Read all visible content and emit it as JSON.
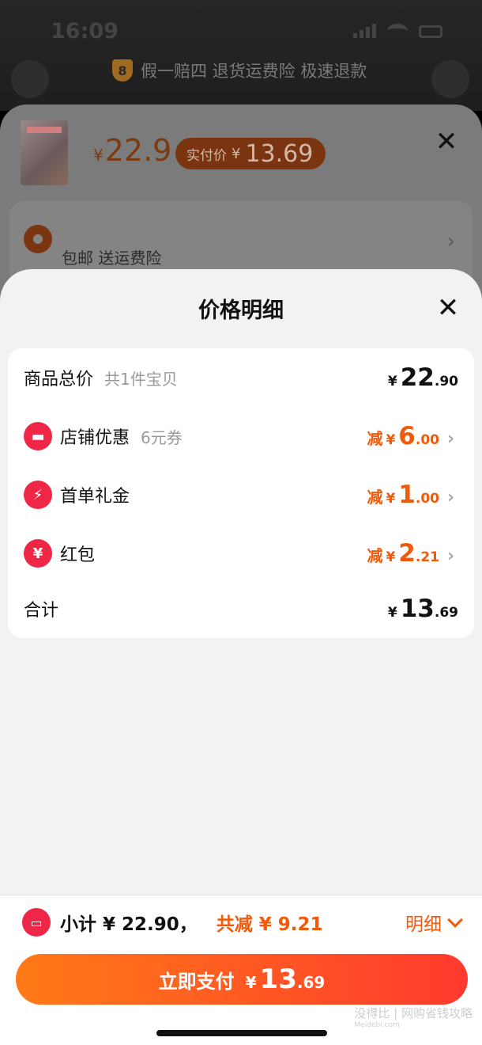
{
  "status_bar": {
    "time": "16:09"
  },
  "guarantee": {
    "shield_char": "8",
    "text": "假一赔四 退货运费险 极速退款"
  },
  "product": {
    "currency": "¥",
    "price": "22.9",
    "paid_label": "实付价",
    "paid_currency": "¥",
    "paid_price": "13.69"
  },
  "shipping": {
    "text": "包邮  送运费险"
  },
  "sheet": {
    "title": "价格明细",
    "close_char": "✕"
  },
  "detail": {
    "total": {
      "label": "商品总价",
      "sub": "共1件宝贝",
      "currency": "¥",
      "int": "22",
      "dec": ".90"
    },
    "items": [
      {
        "label": "店铺优惠",
        "sub": "6元券",
        "prefix": "减",
        "currency": "¥",
        "int": "6",
        "dec": ".00",
        "icon": "store-icon"
      },
      {
        "label": "首单礼金",
        "sub": "",
        "prefix": "减",
        "currency": "¥",
        "int": "1",
        "dec": ".00",
        "icon": "lightning-icon"
      },
      {
        "label": "红包",
        "sub": "",
        "prefix": "减",
        "currency": "¥",
        "int": "2",
        "dec": ".21",
        "icon": "red-packet-icon"
      }
    ],
    "sum": {
      "label": "合计",
      "currency": "¥",
      "int": "13",
      "dec": ".69"
    }
  },
  "bottom": {
    "subtotal_text": "小计 ¥ 22.90，",
    "saving_text": "共减 ¥ 9.21",
    "detail_label": "明细",
    "pay_label": "立即支付",
    "pay_currency": "¥",
    "pay_int": "13",
    "pay_dec": ".69"
  },
  "watermark": {
    "brand": "没得比",
    "url": "Meidebi.com",
    "slogan": "网购省钱攻略"
  },
  "colors": {
    "accent": "#f25a0b",
    "badge": "#ee2747",
    "button_start": "#ff7a16",
    "button_end": "#ff3a2e"
  }
}
